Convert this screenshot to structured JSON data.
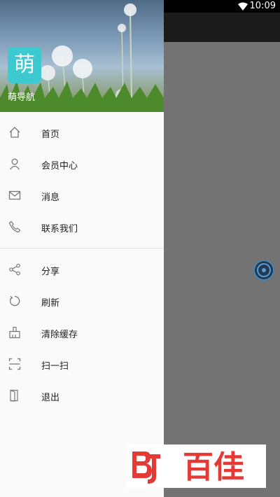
{
  "status_bar": {
    "time": "10:09",
    "wifi_icon": "wifi-icon"
  },
  "drawer": {
    "app_logo_char": "萌",
    "app_name": "萌导航",
    "logo_color": "#3cc9cf",
    "primary_items": [
      {
        "label": "首页",
        "icon": "home-icon"
      },
      {
        "label": "会员中心",
        "icon": "user-icon"
      },
      {
        "label": "消息",
        "icon": "mail-icon"
      },
      {
        "label": "联系我们",
        "icon": "phone-icon"
      }
    ],
    "secondary_items": [
      {
        "label": "分享",
        "icon": "share-icon"
      },
      {
        "label": "刷新",
        "icon": "refresh-icon"
      },
      {
        "label": "清除缓存",
        "icon": "broom-icon"
      },
      {
        "label": "扫一扫",
        "icon": "scan-icon"
      },
      {
        "label": "退出",
        "icon": "exit-icon"
      }
    ]
  },
  "watermark": {
    "text": "百佳",
    "color": "#e53935"
  }
}
